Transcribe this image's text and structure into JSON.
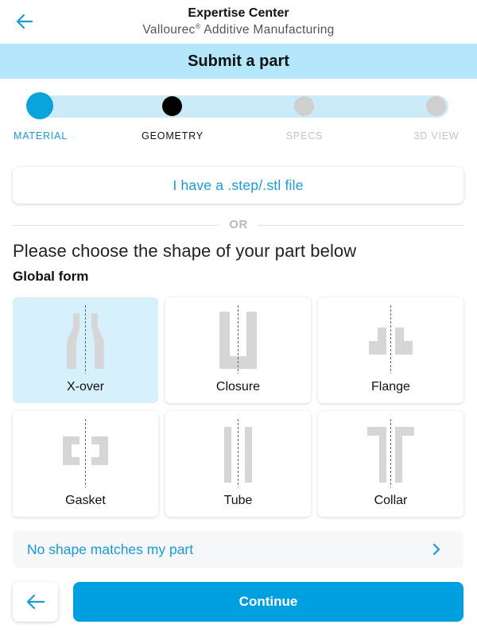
{
  "header": {
    "title": "Expertise Center",
    "subtitle_brand": "Vallourec",
    "subtitle_reg": "®",
    "subtitle_rest": " Additive Manufacturing"
  },
  "banner": {
    "title": "Submit a part"
  },
  "stepper": {
    "current_step": 2,
    "steps": [
      {
        "label": "MATERIAL",
        "state": "done"
      },
      {
        "label": "GEOMETRY",
        "state": "current"
      },
      {
        "label": "SPECS",
        "state": "upcoming"
      },
      {
        "label": "3D VIEW",
        "state": "upcoming"
      }
    ]
  },
  "upload": {
    "label": "I have a .step/.stl file"
  },
  "divider": {
    "label": "OR"
  },
  "prompt": "Please choose the shape of your part below",
  "section_title": "Global form",
  "shapes": [
    {
      "label": "X-over",
      "icon": "x-over-icon",
      "selected": true
    },
    {
      "label": "Closure",
      "icon": "closure-icon",
      "selected": false
    },
    {
      "label": "Flange",
      "icon": "flange-icon",
      "selected": false
    },
    {
      "label": "Gasket",
      "icon": "gasket-icon",
      "selected": false
    },
    {
      "label": "Tube",
      "icon": "tube-icon",
      "selected": false
    },
    {
      "label": "Collar",
      "icon": "collar-icon",
      "selected": false
    }
  ],
  "no_match": {
    "label": "No shape matches my part",
    "icon": "chevron-right-icon"
  },
  "footer": {
    "back_icon": "arrow-left-icon",
    "continue_label": "Continue"
  },
  "colors": {
    "accent": "#009fdf",
    "link": "#1a9ad6",
    "banner": "#b3e7fb",
    "selected_card": "#d6f1fc",
    "shape_gray": "#d6d6d6"
  }
}
